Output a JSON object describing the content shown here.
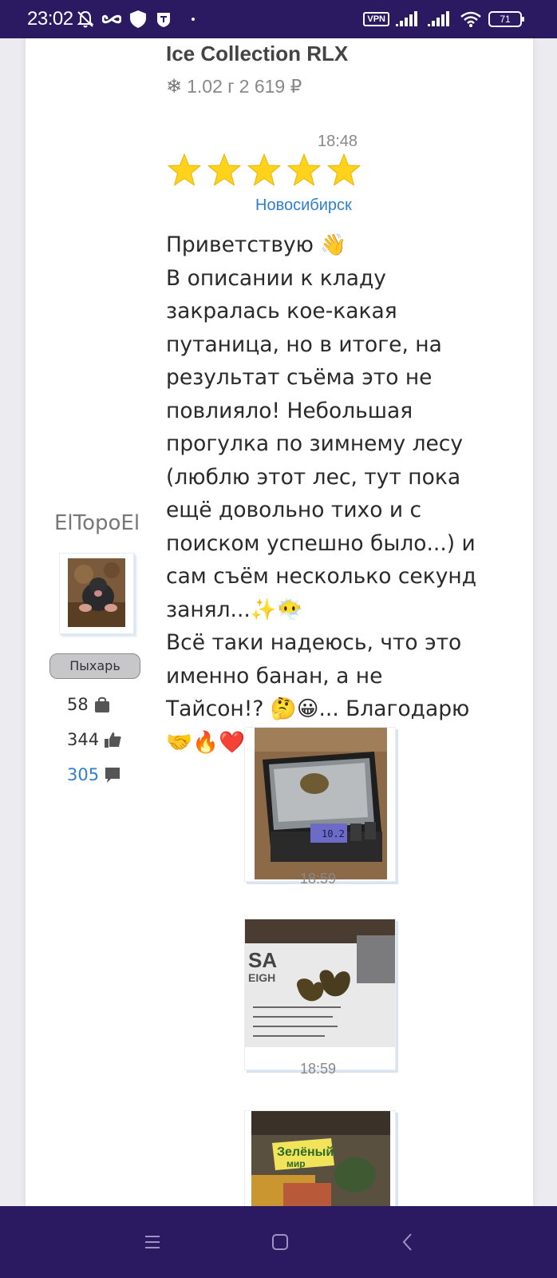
{
  "status_bar": {
    "time": "23:02",
    "vpn_label": "VPN",
    "battery": "71",
    "icons": [
      "bell-off-icon",
      "infinity-icon",
      "shield-icon",
      "brave-icon",
      "wifi-icon",
      "signal-icon"
    ]
  },
  "product": {
    "title": "Ice Collection RLX",
    "icon": "snowflake-icon",
    "weight": "1.02 г",
    "price": "2 619 ₽"
  },
  "review": {
    "time": "18:48",
    "rating": 5,
    "rating_max": 5,
    "city": "Новосибирск",
    "paragraph1": "Приветствую 👋\nВ описании к кладу закралась кое-какая путаница, но в итоге, на результат съёма это не повлияло! Небольшая прогулка по зимнему лесу (люблю этот лес, тут пока ещё довольно тихо и с поиском успешно было...) и сам съём несколько секунд занял...✨😶‍🌫️",
    "paragraph2": "Всё таки надеюсь, что это именно банан, а не Тайсон!? 🤔😀... Благодарю 🤝🔥❤️"
  },
  "author": {
    "name": "ElTopoEl",
    "rank": "Пыхарь",
    "purchases": "58",
    "likes": "344",
    "comments": "305"
  },
  "photos": [
    {
      "time": "18:59",
      "alt": "scale-photo"
    },
    {
      "time": "18:59",
      "alt": "pieces-on-box-photo"
    },
    {
      "time": "",
      "alt": "sign-photo"
    }
  ],
  "colors": {
    "bar_bg": "#2b1a61",
    "link": "#2f7fd0",
    "star": "#ffd21c"
  }
}
